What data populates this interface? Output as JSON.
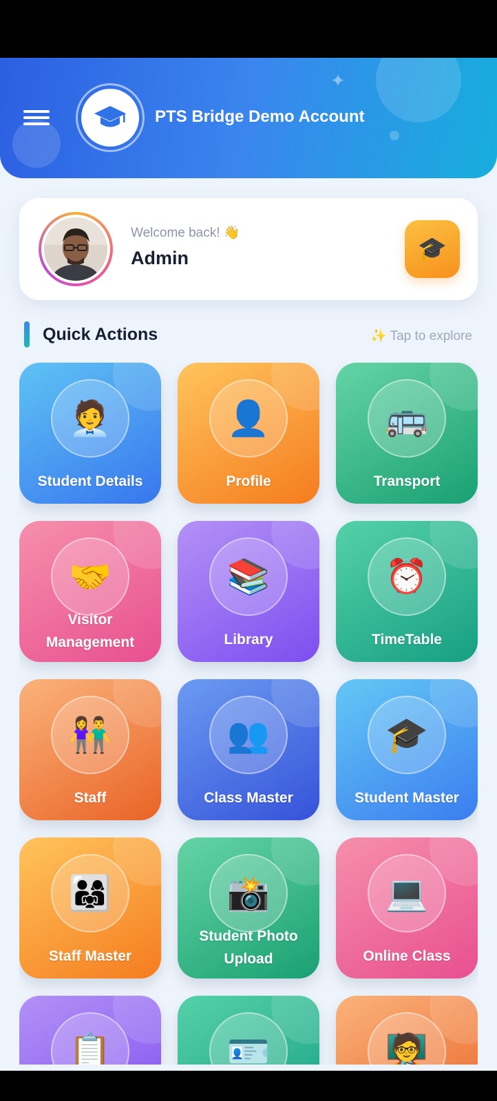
{
  "header": {
    "title": "PTS Bridge Demo Account",
    "gradient_start": "#2c5fe2",
    "gradient_end": "#17aedd"
  },
  "welcome": {
    "greeting": "Welcome back! 👋",
    "name": "Admin"
  },
  "quick_actions": {
    "title": "Quick Actions",
    "hint": "✨ Tap to explore"
  },
  "tiles": [
    {
      "label": "Student Details",
      "icon": "student-edit-icon",
      "glyph": "🧑‍💼",
      "color": "blue"
    },
    {
      "label": "Profile",
      "icon": "profile-icon",
      "glyph": "👤",
      "color": "orange"
    },
    {
      "label": "Transport",
      "icon": "bus-icon",
      "glyph": "🚌",
      "color": "green"
    },
    {
      "label": "Visitor Management",
      "icon": "visitor-icon",
      "glyph": "🤝",
      "color": "pink"
    },
    {
      "label": "Library",
      "icon": "bookshelf-icon",
      "glyph": "📚",
      "color": "purple"
    },
    {
      "label": "TimeTable",
      "icon": "clock-calendar-icon",
      "glyph": "⏰",
      "color": "teal"
    },
    {
      "label": "Staff",
      "icon": "staff-icon",
      "glyph": "👫",
      "color": "peach"
    },
    {
      "label": "Class Master",
      "icon": "group-icon",
      "glyph": "👥",
      "color": "royal"
    },
    {
      "label": "Student Master",
      "icon": "graduate-icon",
      "glyph": "🎓",
      "color": "sky"
    },
    {
      "label": "Staff Master",
      "icon": "team-icon",
      "glyph": "👨‍👩‍👧",
      "color": "orange"
    },
    {
      "label": "Student Photo Upload",
      "icon": "photo-scan-icon",
      "glyph": "📸",
      "color": "green"
    },
    {
      "label": "Online Class",
      "icon": "online-class-icon",
      "glyph": "💻",
      "color": "pink"
    },
    {
      "label": "",
      "icon": "schedule-board-icon",
      "glyph": "📋",
      "color": "purple"
    },
    {
      "label": "",
      "icon": "id-card-icon",
      "glyph": "🪪",
      "color": "teal"
    },
    {
      "label": "",
      "icon": "teacher-icon",
      "glyph": "🧑‍🏫",
      "color": "peach"
    }
  ]
}
